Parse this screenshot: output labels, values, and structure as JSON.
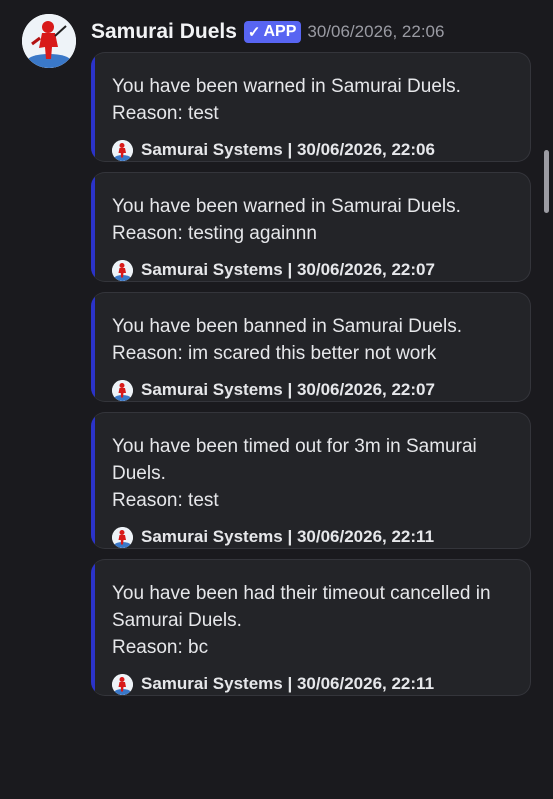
{
  "message": {
    "author": "Samurai Duels",
    "badge": "APP",
    "badge_check": "✓",
    "timestamp": "30/06/2026, 22:06",
    "avatar_icon": "samurai-avatar-icon",
    "accent_color": "#2b33c9",
    "badge_color": "#5865f2"
  },
  "embeds": [
    {
      "lines": [
        "You have been warned in Samurai Duels.",
        "Reason: test"
      ],
      "footer": "Samurai Systems | 30/06/2026, 22:06"
    },
    {
      "lines": [
        "You have been warned in Samurai Duels.",
        "Reason: testing againnn"
      ],
      "footer": "Samurai Systems | 30/06/2026, 22:07"
    },
    {
      "lines": [
        "You have been banned in Samurai Duels.",
        "Reason: im scared this better not work"
      ],
      "footer": "Samurai Systems | 30/06/2026, 22:07"
    },
    {
      "lines": [
        "You have been timed out for 3m in Samurai Duels.",
        "Reason: test"
      ],
      "footer": "Samurai Systems | 30/06/2026, 22:11"
    },
    {
      "lines": [
        "You have been had their timeout cancelled in Samurai Duels.",
        "Reason: bc"
      ],
      "footer": "Samurai Systems | 30/06/2026, 22:11"
    }
  ]
}
